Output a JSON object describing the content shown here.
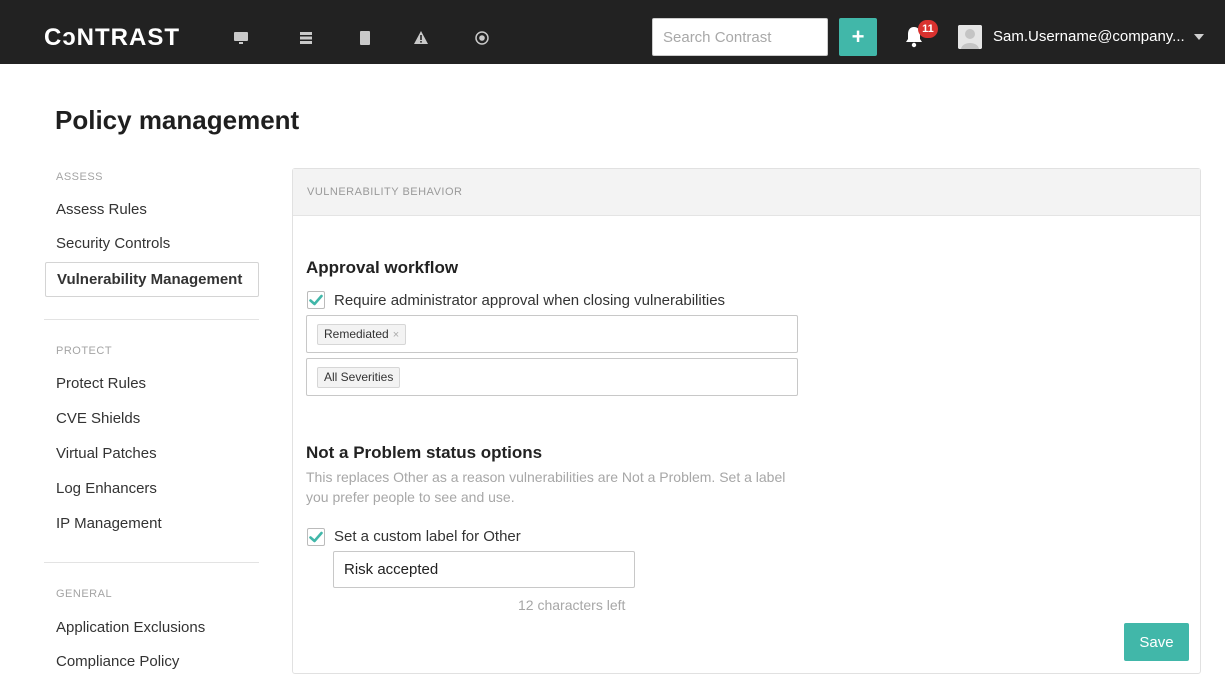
{
  "app": {
    "logo_text": "CɔNTRAST"
  },
  "topbar": {
    "nav_icons": [
      "monitor-icon",
      "server-icon",
      "book-icon",
      "warning-icon",
      "target-icon"
    ],
    "search_placeholder": "Search Contrast",
    "add_label": "+",
    "notification_count": "11",
    "user_name": "Sam.Username@company..."
  },
  "page": {
    "title": "Policy management"
  },
  "sidebar": {
    "sections": [
      {
        "label": "ASSESS",
        "items": [
          "Assess Rules",
          "Security Controls",
          "Vulnerability Management"
        ]
      },
      {
        "label": "PROTECT",
        "items": [
          "Protect Rules",
          "CVE Shields",
          "Virtual Patches",
          "Log Enhancers",
          "IP Management"
        ]
      },
      {
        "label": "GENERAL",
        "items": [
          "Application Exclusions",
          "Compliance Policy"
        ]
      }
    ],
    "active_item": "Vulnerability Management"
  },
  "panel": {
    "header": "VULNERABILITY BEHAVIOR",
    "approval": {
      "title": "Approval workflow",
      "checkbox_label": "Require administrator approval when closing vulnerabilities",
      "checked": true,
      "status_tag": "Remediated",
      "status_tag_remove": "×",
      "severity_tag": "All Severities"
    },
    "nap": {
      "title": "Not a Problem status options",
      "description": "This replaces Other as a reason vulnerabilities are Not a Problem. Set a label you prefer people to see and use.",
      "checkbox_label": "Set a custom label for Other",
      "checked": true,
      "input_value": "Risk accepted",
      "chars_left": "12 characters left"
    },
    "save_label": "Save"
  },
  "colors": {
    "topbar_bg": "#222222",
    "accent": "#41b7a9",
    "badge": "#d9322f"
  }
}
